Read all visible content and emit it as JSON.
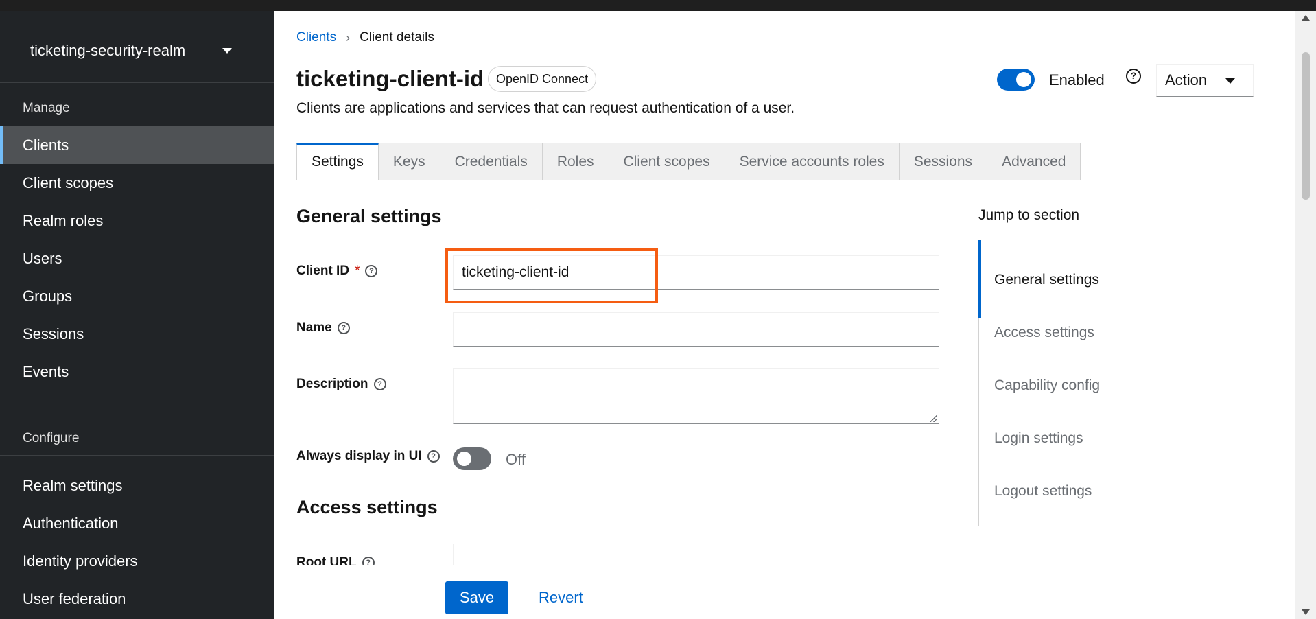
{
  "sidebar": {
    "realm_selector": "ticketing-security-realm",
    "manage_heading": "Manage",
    "manage_items": [
      {
        "label": "Clients"
      },
      {
        "label": "Client scopes"
      },
      {
        "label": "Realm roles"
      },
      {
        "label": "Users"
      },
      {
        "label": "Groups"
      },
      {
        "label": "Sessions"
      },
      {
        "label": "Events"
      }
    ],
    "configure_heading": "Configure",
    "configure_items": [
      {
        "label": "Realm settings"
      },
      {
        "label": "Authentication"
      },
      {
        "label": "Identity providers"
      },
      {
        "label": "User federation"
      }
    ]
  },
  "breadcrumb": {
    "parent": "Clients",
    "current": "Client details"
  },
  "header": {
    "title": "ticketing-client-id",
    "protocol_badge": "OpenID Connect",
    "subtitle": "Clients are applications and services that can request authentication of a user.",
    "enabled_label": "Enabled",
    "enabled": true,
    "help_glyph": "?",
    "action_label": "Action"
  },
  "tabs": [
    {
      "label": "Settings"
    },
    {
      "label": "Keys"
    },
    {
      "label": "Credentials"
    },
    {
      "label": "Roles"
    },
    {
      "label": "Client scopes"
    },
    {
      "label": "Service accounts roles"
    },
    {
      "label": "Sessions"
    },
    {
      "label": "Advanced"
    }
  ],
  "form": {
    "general_title": "General settings",
    "client_id_label": "Client ID",
    "required_mark": "*",
    "client_id_value": "ticketing-client-id",
    "name_label": "Name",
    "name_value": "",
    "description_label": "Description",
    "description_value": "",
    "always_display_label": "Always display in UI",
    "always_display_state": "Off",
    "access_title": "Access settings",
    "root_url_label": "Root URL",
    "root_url_value": ""
  },
  "jump": {
    "title": "Jump to section",
    "items": [
      {
        "label": "General settings"
      },
      {
        "label": "Access settings"
      },
      {
        "label": "Capability config"
      },
      {
        "label": "Login settings"
      },
      {
        "label": "Logout settings"
      }
    ]
  },
  "footer": {
    "save_label": "Save",
    "revert_label": "Revert"
  },
  "colors": {
    "sidebar_bg": "#212427",
    "primary": "#0066cc",
    "highlight": "#f55d12",
    "active_indicator": "#73bcf7"
  }
}
